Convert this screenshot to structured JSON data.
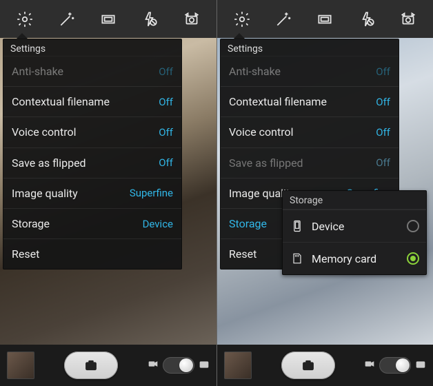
{
  "left": {
    "settings": {
      "title": "Settings",
      "rows": [
        {
          "label": "Anti-shake",
          "value": "Off"
        },
        {
          "label": "Contextual filename",
          "value": "Off"
        },
        {
          "label": "Voice control",
          "value": "Off"
        },
        {
          "label": "Save as flipped",
          "value": "Off"
        },
        {
          "label": "Image quality",
          "value": "Superfine"
        },
        {
          "label": "Storage",
          "value": "Device"
        },
        {
          "label": "Reset",
          "value": ""
        }
      ]
    }
  },
  "right": {
    "settings": {
      "title": "Settings",
      "rows": [
        {
          "label": "Anti-shake",
          "value": "Off"
        },
        {
          "label": "Contextual filename",
          "value": "Off"
        },
        {
          "label": "Voice control",
          "value": "Off"
        },
        {
          "label": "Save as flipped",
          "value": "Off"
        },
        {
          "label": "Image quality",
          "value": "Superfine"
        },
        {
          "label": "Storage",
          "value": ""
        },
        {
          "label": "Reset",
          "value": ""
        }
      ]
    },
    "storage_popover": {
      "title": "Storage",
      "option_device": "Device",
      "option_memory_card": "Memory card",
      "selected": "memory_card"
    }
  }
}
